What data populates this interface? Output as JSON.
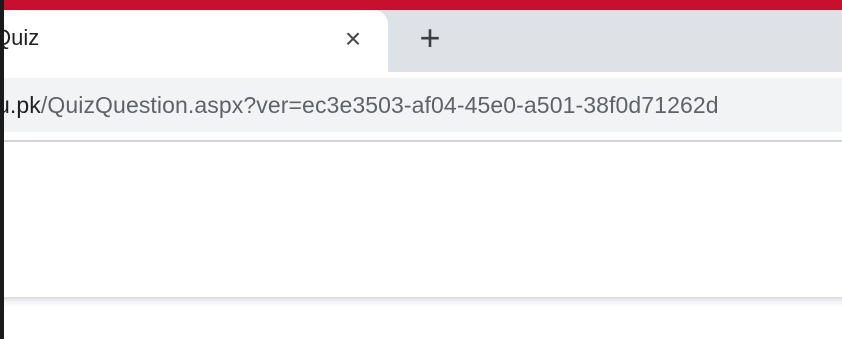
{
  "browser": {
    "accent_color": "#c8102e",
    "tab": {
      "title": "Quiz",
      "close_icon": "×"
    },
    "new_tab_icon": "+",
    "address_bar": {
      "domain": "u.pk",
      "path": "/QuizQuestion.aspx?ver=ec3e3503-af04-45e0-a501-38f0d71262d"
    }
  }
}
